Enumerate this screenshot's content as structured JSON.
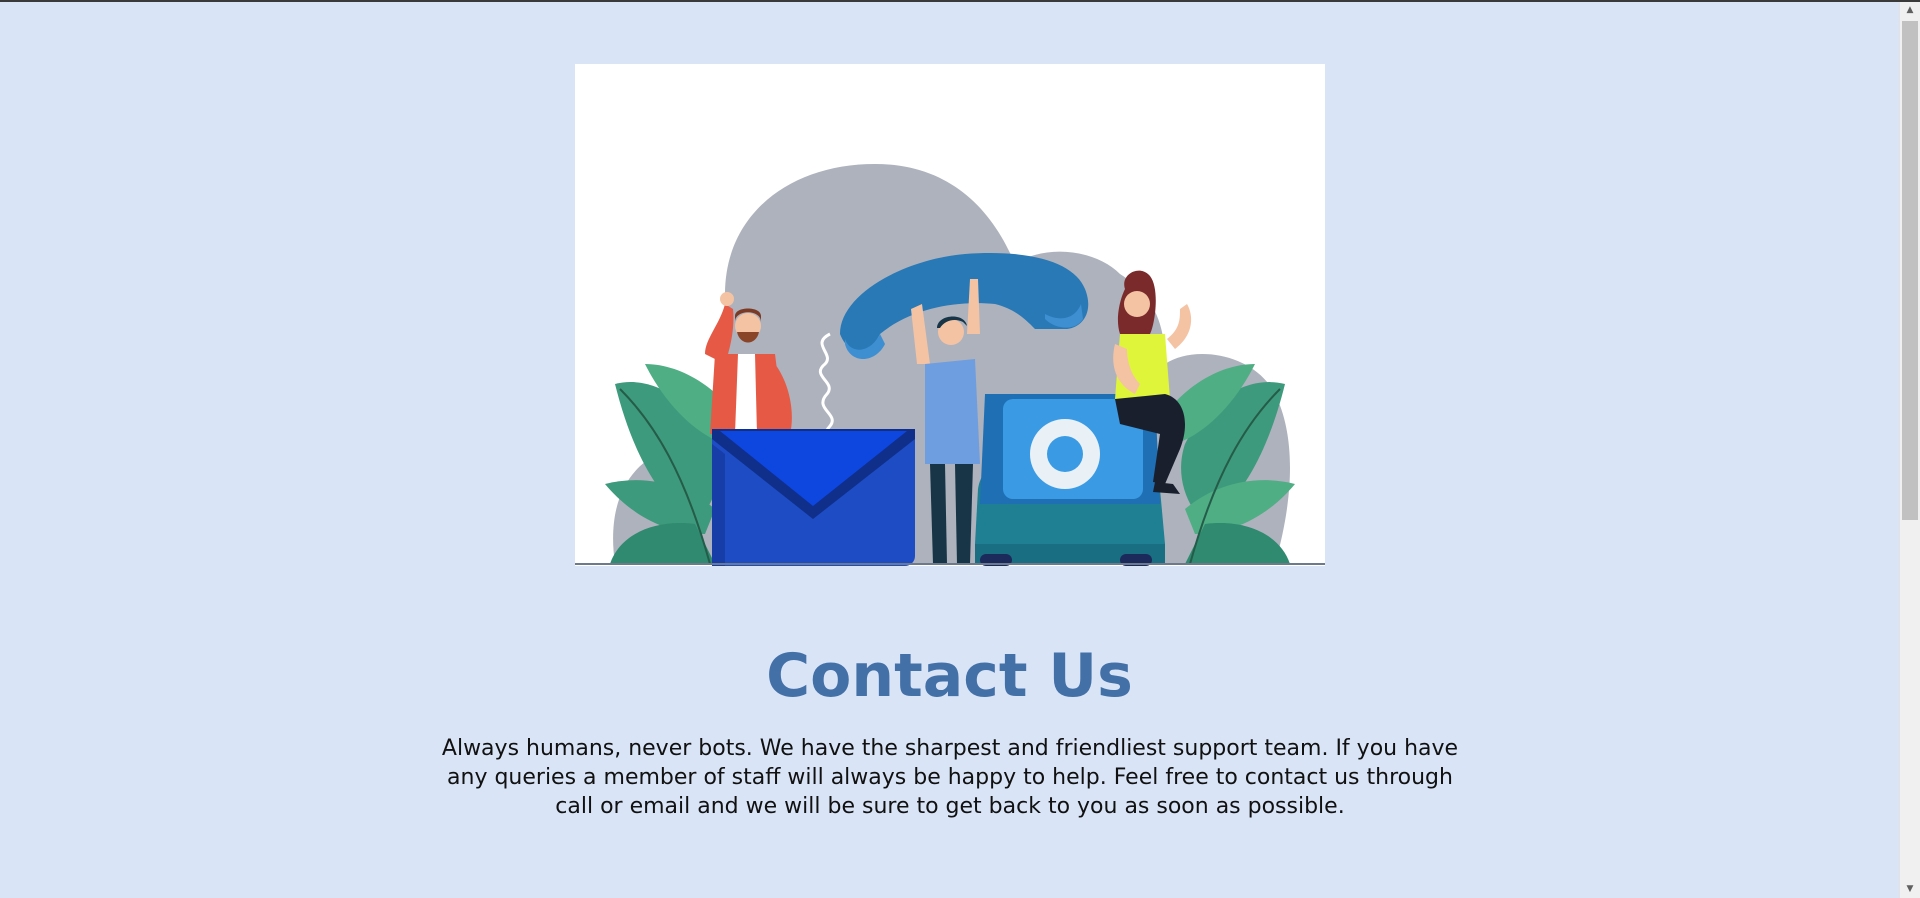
{
  "hero_image": {
    "icon": "contact-illustration"
  },
  "heading": {
    "title": "Contact Us"
  },
  "body": {
    "description": "Always humans, never bots. We have the sharpest and friendliest support team. If you have any queries a member of staff will always be happy to help. Feel free to contact us through call or email and we will be sure to get back to you as soon as possible."
  },
  "scrollbar": {
    "up_glyph": "▲",
    "down_glyph": "▼"
  },
  "colors": {
    "background": "#d9e5f7",
    "title": "#4470a8",
    "text": "#111111"
  }
}
